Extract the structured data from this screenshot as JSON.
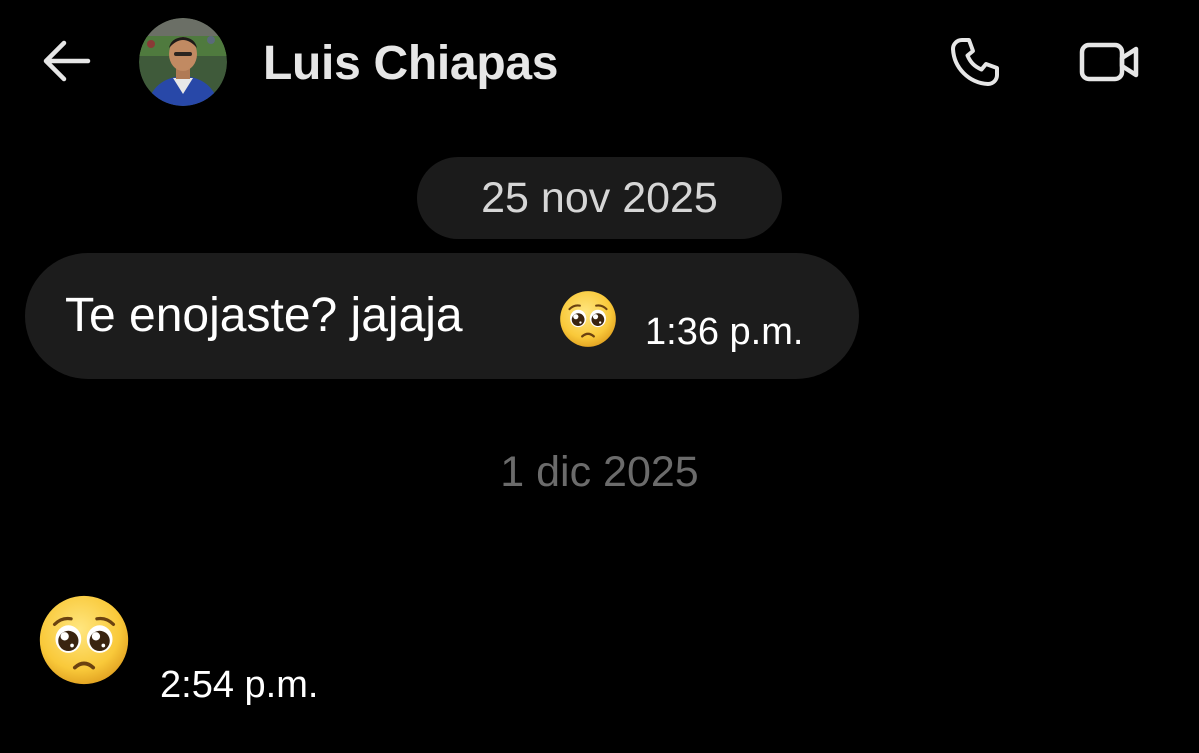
{
  "header": {
    "back_icon": "arrow-left-icon",
    "contact_name": "Luis Chiapas",
    "avatar": "contact-photo",
    "call_icon": "phone-icon",
    "video_icon": "video-camera-icon"
  },
  "conversation": {
    "first_date": "25 nov 2025",
    "message1": {
      "text": "Te enojaste? jajaja",
      "emoji": "pleading-face-emoji",
      "time": "1:36 p.m."
    },
    "second_date": "1 dic 2025",
    "message2": {
      "emoji": "pleading-face-emoji",
      "time": "2:54 p.m."
    }
  },
  "colors": {
    "background": "#000000",
    "bubble": "#1c1c1c",
    "date_pill": "#1b1b1b",
    "muted_text": "#6b6b6b"
  }
}
